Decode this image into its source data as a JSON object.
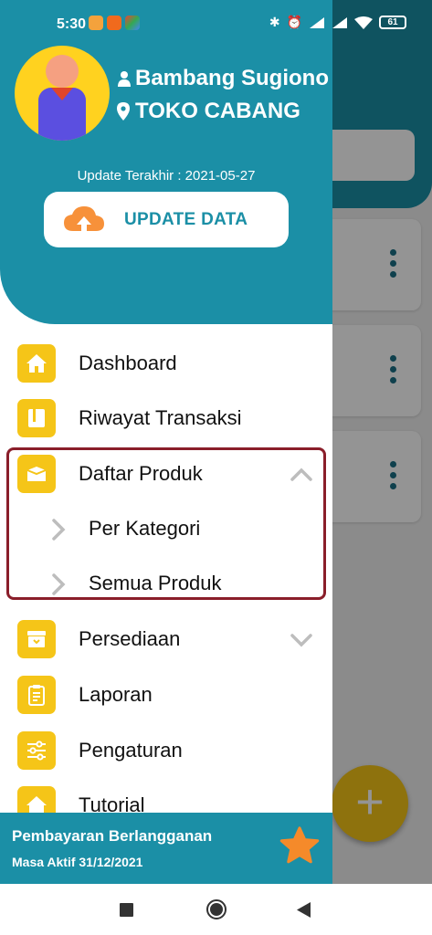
{
  "status_bar": {
    "time": "5:30",
    "battery": "61"
  },
  "user": {
    "name": "Bambang Sugiono",
    "store": "TOKO CABANG"
  },
  "last_update": "Update Terakhir : 2021-05-27",
  "update_button": {
    "label": "UPDATE DATA"
  },
  "menu": {
    "dashboard": "Dashboard",
    "riwayat": "Riwayat Transaksi",
    "daftar_produk": "Daftar Produk",
    "per_kategori": "Per Kategori",
    "semua_produk": "Semua Produk",
    "persediaan": "Persediaan",
    "laporan": "Laporan",
    "pengaturan": "Pengaturan",
    "tutorial": "Tutorial"
  },
  "subscription": {
    "title": "Pembayaran Berlangganan",
    "active_until": "Masa Aktif 31/12/2021"
  },
  "colors": {
    "primary": "#1b8fa6",
    "accent": "#f5c518",
    "star": "#f58a2a",
    "highlight": "#8a1e2a"
  }
}
